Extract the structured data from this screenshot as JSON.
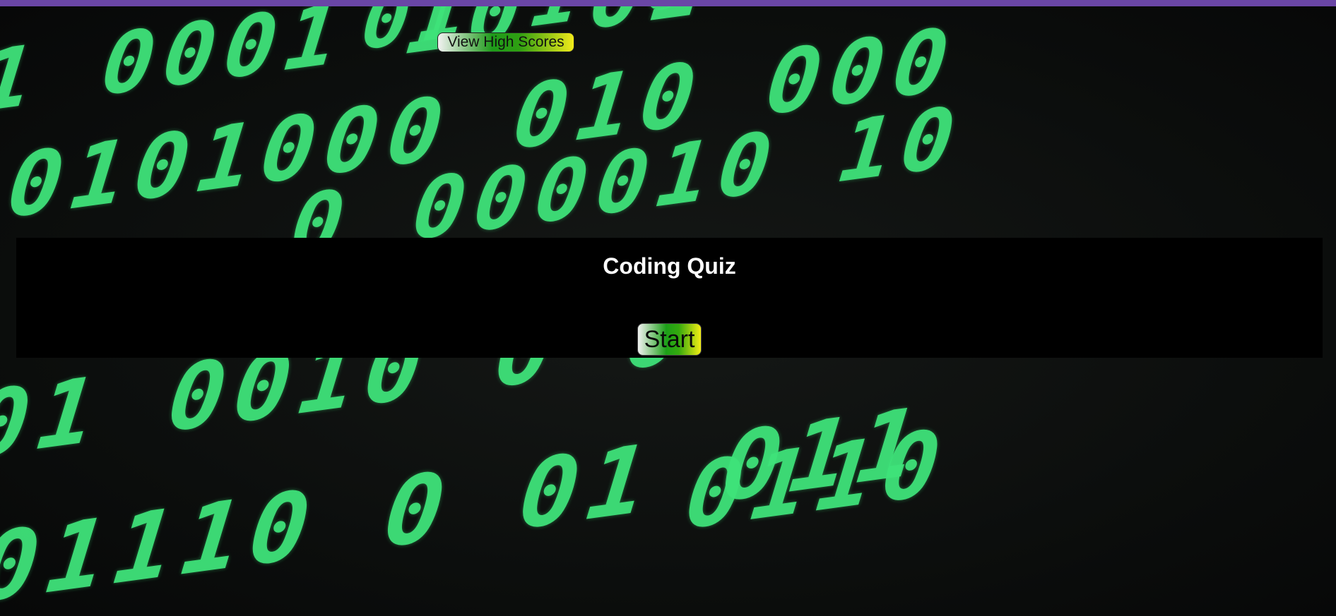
{
  "header": {
    "high_scores_label": "View High Scores"
  },
  "quiz": {
    "title": "Coding Quiz",
    "start_label": "Start"
  },
  "background": {
    "pattern": "green binary digits on dark background",
    "digit_color": "#3fe37a",
    "rows": [
      "0001  10",
      "000001 0111 0",
      "0101000   0000",
      "01000010 10",
      "01   00100 00",
      "001 0011100 0",
      "0 01110 0110 011"
    ]
  },
  "colors": {
    "top_border": "#6a46a6",
    "panel": "#000000",
    "title_text": "#ffffff",
    "button_gradient": [
      "#f2f2f2",
      "#1e9a1a",
      "#f1ea1a"
    ]
  }
}
